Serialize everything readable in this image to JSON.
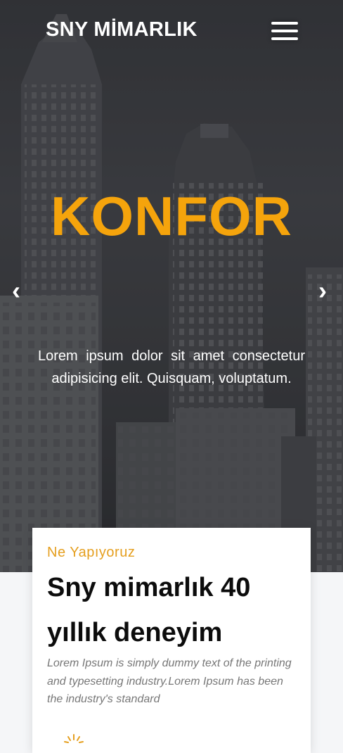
{
  "header": {
    "brand": "SNY MİMARLIK",
    "menu_icon": "hamburger-menu-icon"
  },
  "hero": {
    "title": "KONFOR",
    "text": "Lorem ipsum dolor sit amet consectetur adipisicing elit. Quisquam, voluptatum.",
    "prev_arrow": "‹",
    "next_arrow": "›",
    "title_color": "#f5a40c"
  },
  "about": {
    "eyebrow": "Ne Yapıyoruz",
    "headline": "Sny mimarlık 40 yıllık deneyim",
    "description": "Lorem Ipsum is simply dummy text of the printing and typesetting industry.Lorem Ipsum has been the industry's standard",
    "accent_color": "#e59f1f",
    "icon": "lightbulb-icon"
  }
}
